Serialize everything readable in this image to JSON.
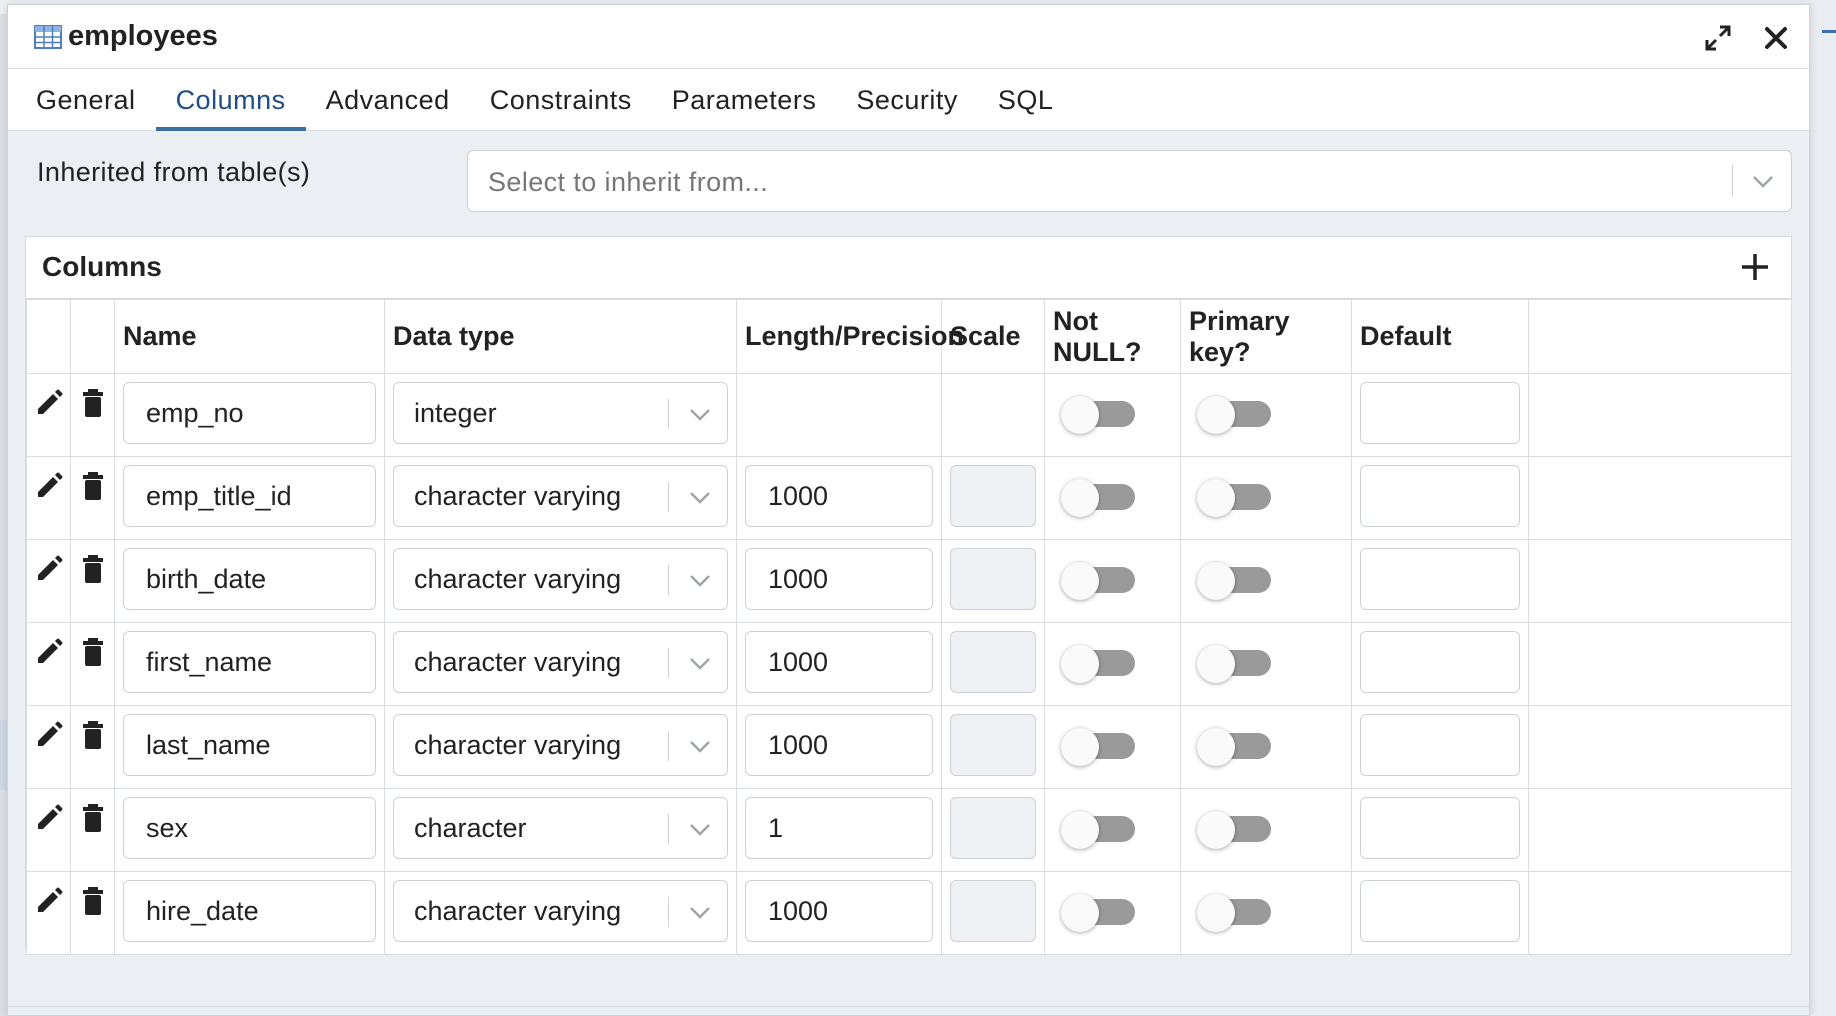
{
  "dialog": {
    "title": "employees"
  },
  "tabs": [
    {
      "label": "General",
      "active": false
    },
    {
      "label": "Columns",
      "active": true
    },
    {
      "label": "Advanced",
      "active": false
    },
    {
      "label": "Constraints",
      "active": false
    },
    {
      "label": "Parameters",
      "active": false
    },
    {
      "label": "Security",
      "active": false
    },
    {
      "label": "SQL",
      "active": false
    }
  ],
  "inherit": {
    "label": "Inherited from table(s)",
    "placeholder": "Select to inherit from..."
  },
  "columns_panel": {
    "title": "Columns",
    "headers": [
      "Name",
      "Data type",
      "Length/Precision",
      "Scale",
      "Not NULL?",
      "Primary key?",
      "Default"
    ],
    "rows": [
      {
        "name": "emp_no",
        "data_type": "integer",
        "length": "",
        "scale": "",
        "not_null": false,
        "primary_key": false,
        "default": ""
      },
      {
        "name": "emp_title_id",
        "data_type": "character varying",
        "length": "1000",
        "scale": "",
        "not_null": false,
        "primary_key": false,
        "default": ""
      },
      {
        "name": "birth_date",
        "data_type": "character varying",
        "length": "1000",
        "scale": "",
        "not_null": false,
        "primary_key": false,
        "default": ""
      },
      {
        "name": "first_name",
        "data_type": "character varying",
        "length": "1000",
        "scale": "",
        "not_null": false,
        "primary_key": false,
        "default": ""
      },
      {
        "name": "last_name",
        "data_type": "character varying",
        "length": "1000",
        "scale": "",
        "not_null": false,
        "primary_key": false,
        "default": ""
      },
      {
        "name": "sex",
        "data_type": "character",
        "length": "1",
        "scale": "",
        "not_null": false,
        "primary_key": false,
        "default": ""
      },
      {
        "name": "hire_date",
        "data_type": "character varying",
        "length": "1000",
        "scale": "",
        "not_null": false,
        "primary_key": false,
        "default": ""
      }
    ]
  },
  "icons": {
    "title": "table-icon",
    "maximize": "expand-icon",
    "close": "close-icon",
    "add": "plus-icon",
    "edit": "pencil-icon",
    "delete": "trash-icon",
    "dropdown": "chevron-down-icon"
  },
  "colors": {
    "accent": "#3a6ea5",
    "toggle_off": "#9a9a9a"
  }
}
